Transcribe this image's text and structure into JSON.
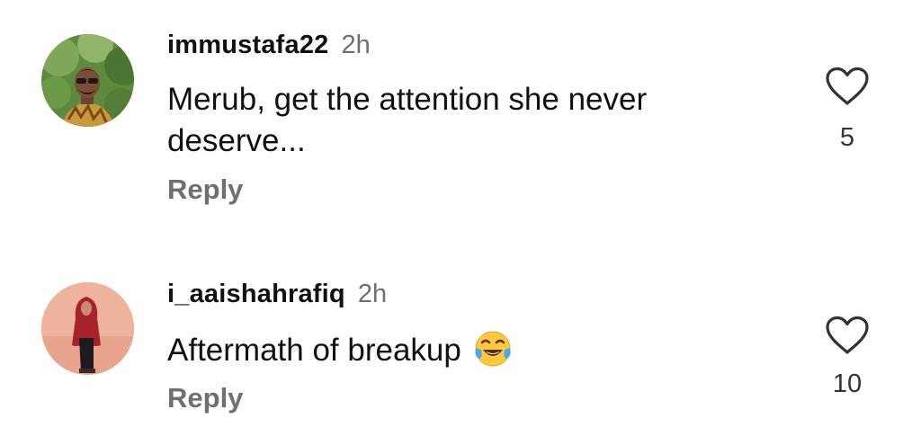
{
  "comments": [
    {
      "username": "immustafa22",
      "time": "2h",
      "text": "Merub, get the attention she never deserve...",
      "reply_label": "Reply",
      "like_count": "5",
      "avatar": "avatar-man-sunglasses-greenery"
    },
    {
      "username": "i_aaishahrafiq",
      "time": "2h",
      "text": "Aftermath of breakup",
      "emoji": "tears-of-joy-emoji",
      "reply_label": "Reply",
      "like_count": "10",
      "avatar": "avatar-woman-red-hijab"
    }
  ],
  "icons": {
    "like": "heart-outline-icon"
  },
  "colors": {
    "text": "#111111",
    "secondary": "#6f6f6f",
    "background": "#ffffff"
  }
}
